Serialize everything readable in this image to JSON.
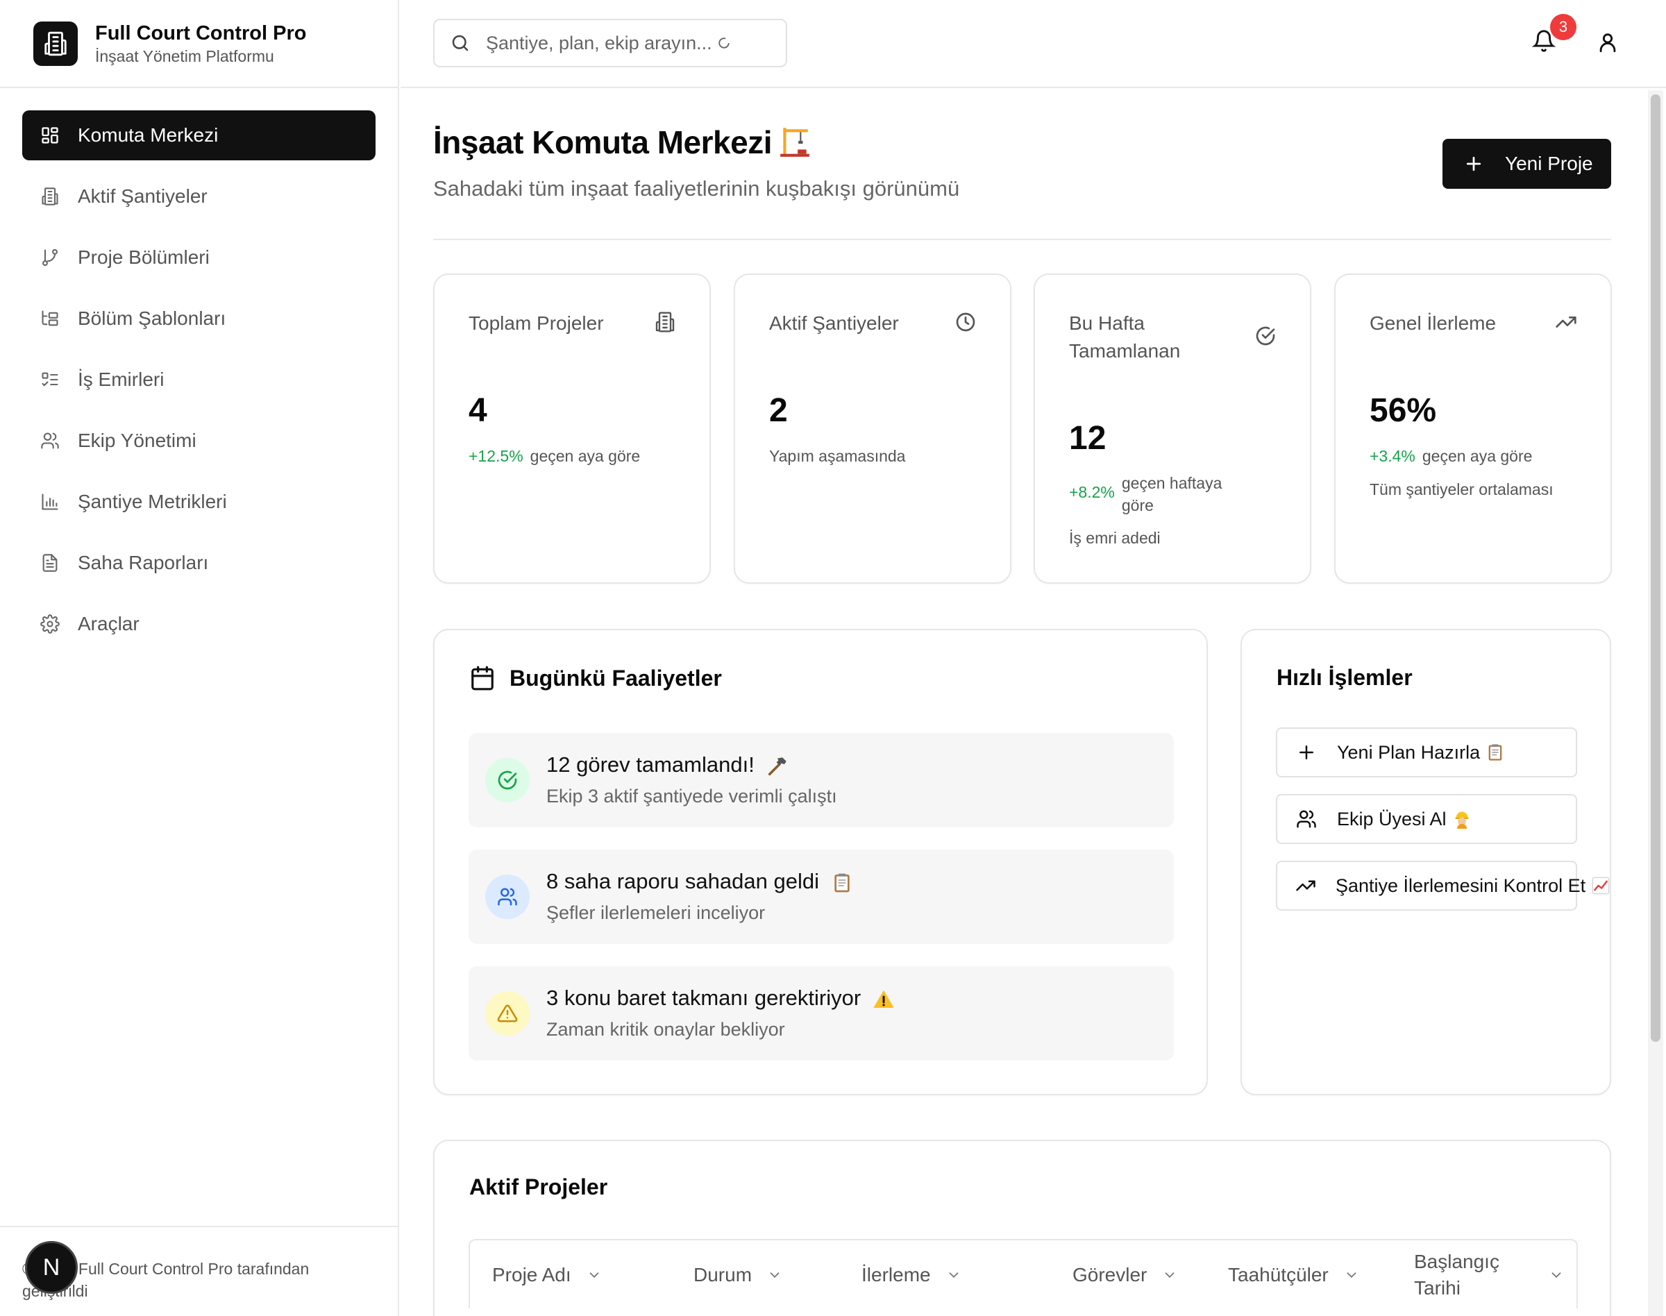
{
  "brand": {
    "title": "Full Court Control Pro",
    "subtitle": "İnşaat Yönetim Platformu",
    "logo_icon": "building-icon"
  },
  "sidebar": {
    "items": [
      {
        "label": "Komuta Merkezi",
        "icon": "dashboard-grid-icon",
        "active": true
      },
      {
        "label": "Aktif Şantiyeler",
        "icon": "building-icon"
      },
      {
        "label": "Proje Bölümleri",
        "icon": "git-branch-icon"
      },
      {
        "label": "Bölüm Şablonları",
        "icon": "tree-structure-icon"
      },
      {
        "label": "İş Emirleri",
        "icon": "checklist-icon"
      },
      {
        "label": "Ekip Yönetimi",
        "icon": "users-icon"
      },
      {
        "label": "Şantiye Metrikleri",
        "icon": "bar-chart-icon"
      },
      {
        "label": "Saha Raporları",
        "icon": "document-icon"
      },
      {
        "label": "Araçlar",
        "icon": "gear-icon"
      }
    ],
    "footer": "© 2025 Full Court Control Pro tarafından geliştirildi",
    "avatar_letter": "N"
  },
  "header": {
    "search_placeholder": "Şantiye, plan, ekip arayın...",
    "notification_count": "3"
  },
  "page": {
    "title": "İnşaat Komuta Merkezi",
    "title_emoji": "construction-crane",
    "subtitle": "Sahadaki tüm inşaat faaliyetlerinin kuşbakışı görünümü",
    "new_button": "Yeni Proje"
  },
  "stats": [
    {
      "title": "Toplam Projeler",
      "value": "4",
      "change": "+12.5%",
      "change_text": "geçen aya göre",
      "note": "",
      "icon": "building-icon"
    },
    {
      "title": "Aktif Şantiyeler",
      "value": "2",
      "change": "",
      "change_text": "Yapım aşamasında",
      "note": "",
      "icon": "clock-icon"
    },
    {
      "title": "Bu Hafta Tamamlanan",
      "value": "12",
      "change": "+8.2%",
      "change_text": "geçen haftaya göre",
      "note": "İş emri adedi",
      "icon": "check-circle-icon"
    },
    {
      "title": "Genel İlerleme",
      "value": "56%",
      "change": "+3.4%",
      "change_text": "geçen aya göre",
      "note": "Tüm şantiyeler ortalaması",
      "icon": "trending-up-icon"
    }
  ],
  "activities": {
    "title": "Bugünkü Faaliyetler",
    "items": [
      {
        "title": "12 görev tamamlandı!",
        "subtitle": "Ekip 3 aktif şantiyede verimli çalıştı",
        "icon": "check-circle-icon",
        "color": "#16a34a",
        "bg": "#dcfce7",
        "emoji": "hammer"
      },
      {
        "title": "8 saha raporu sahadan geldi",
        "subtitle": "Şefler ilerlemeleri inceliyor",
        "icon": "users-icon",
        "color": "#2563eb",
        "bg": "#dbeafe",
        "emoji": "clipboard"
      },
      {
        "title": "3 konu baret takmanı gerektiriyor",
        "subtitle": "Zaman kritik onaylar bekliyor",
        "icon": "warning-icon",
        "color": "#ca8a04",
        "bg": "#fef9c3",
        "emoji": "warning"
      }
    ]
  },
  "quick_actions": {
    "title": "Hızlı İşlemler",
    "items": [
      {
        "label": "Yeni Plan Hazırla",
        "icon": "plus-icon",
        "emoji": "clipboard"
      },
      {
        "label": "Ekip Üyesi Al",
        "icon": "users-icon",
        "emoji": "construction-worker"
      },
      {
        "label": "Şantiye İlerlemesini Kontrol Et",
        "icon": "trending-up-icon",
        "emoji": "chart-increasing"
      }
    ]
  },
  "projects": {
    "title": "Aktif Projeler",
    "columns": [
      "Proje Adı",
      "Durum",
      "İlerleme",
      "Görevler",
      "Taahütçüler",
      "Başlangıç Tarihi"
    ]
  },
  "colors": {
    "primary": "#111111",
    "positive": "#16a34a",
    "badge": "#ef3b3b"
  }
}
